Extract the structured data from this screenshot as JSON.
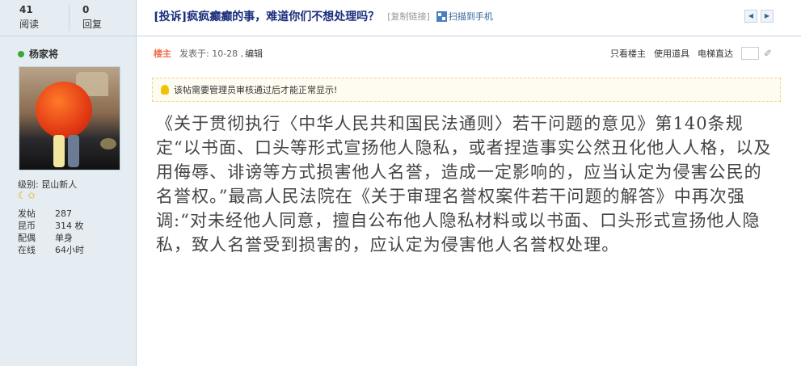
{
  "header": {
    "views_count": "41",
    "views_label": "阅读",
    "replies_count": "0",
    "replies_label": "回复",
    "thread_title": "[投诉]疯疯癫癫的事，难道你们不想处理吗？",
    "copy_link_label": "[复制链接]",
    "scan_label": "扫描到手机",
    "qr_icon": "qr-code-icon",
    "prev_icon": "chevron-left-icon",
    "next_icon": "chevron-right-icon"
  },
  "user": {
    "name": "杨家将",
    "online_icon": "online-status-icon",
    "level": "级别: 昆山新人",
    "level_icons": [
      "moon-icon",
      "star-icon"
    ],
    "stats": [
      {
        "key": "发帖",
        "value": "287"
      },
      {
        "key": "昆币",
        "value": "314 枚"
      },
      {
        "key": "配偶",
        "value": "单身"
      },
      {
        "key": "在线",
        "value": "64小时"
      }
    ]
  },
  "post": {
    "floor_label": "楼主",
    "posted_at": "发表于: 10-28 ,",
    "edit_label": "编辑",
    "tools": {
      "only_author": "只看楼主",
      "use_item": "使用道具",
      "goto_floor": "电梯直达"
    },
    "notice": "该帖需要管理员审核通过后才能正常显示!",
    "body": "《关于贯彻执行〈中华人民共和国民法通则〉若干问题的意见》第140条规定“以书面、口头等形式宣扬他人隐私，或者捏造事实公然丑化他人人格，以及用侮辱、诽谤等方式损害他人名誉，造成一定影响的，应当认定为侵害公民的名誉权。”最高人民法院在《关于审理名誉权案件若干问题的解答》中再次强调:“对未经他人同意，擅自公布他人隐私材料或以书面、口头形式宣扬他人隐私，致人名誉受到损害的，应认定为侵害他人名誉权处理。"
  },
  "colors": {
    "sidebar_bg": "#e5edf2",
    "border": "#c2d5e3",
    "title_blue": "#1a2e7c",
    "floor_orange": "#f26c4f",
    "notice_bg": "#fefbf0"
  }
}
